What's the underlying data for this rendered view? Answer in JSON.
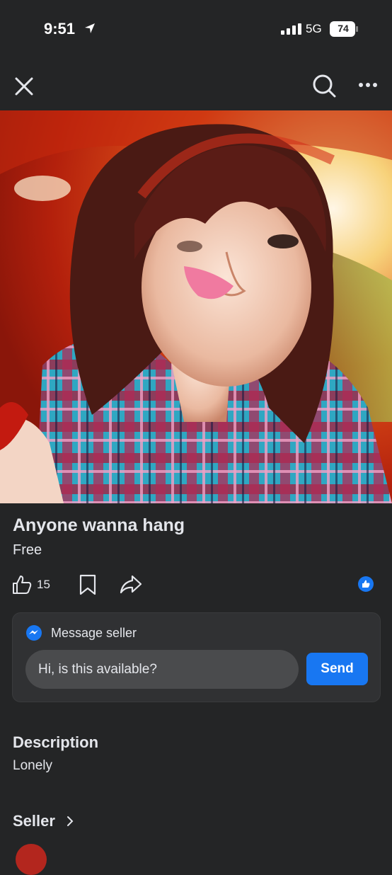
{
  "status_bar": {
    "time": "9:51",
    "network": "5G",
    "battery": "74"
  },
  "nav": {
    "close_icon": "close-icon",
    "search_icon": "search-icon",
    "more_icon": "more-icon"
  },
  "listing": {
    "title": "Anyone wanna hang",
    "price": "Free",
    "like_count": "15"
  },
  "message_card": {
    "title": "Message seller",
    "input_value": "Hi, is this available?",
    "send_label": "Send"
  },
  "description": {
    "heading": "Description",
    "text": "Lonely"
  },
  "seller": {
    "heading": "Seller"
  },
  "colors": {
    "background": "#242526",
    "card": "#303133",
    "accent": "#1877f2",
    "text": "#e4e6eb"
  }
}
